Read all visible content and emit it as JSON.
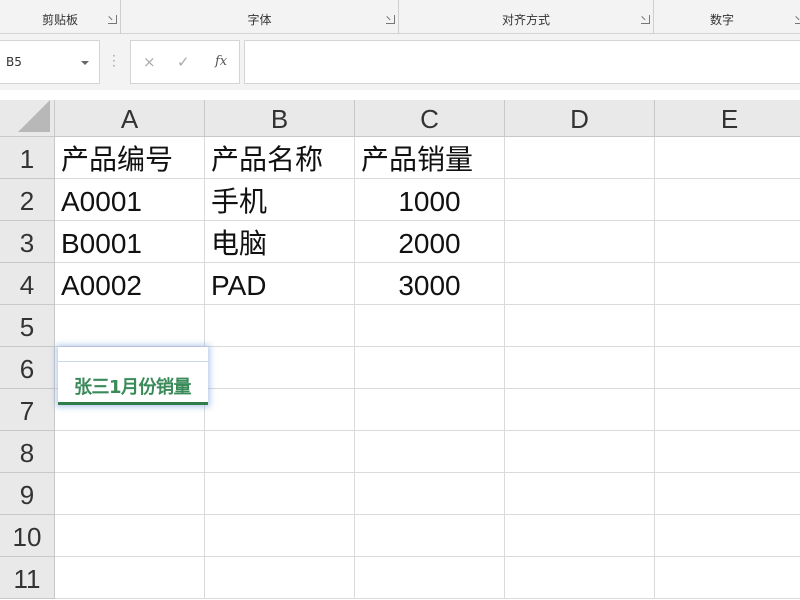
{
  "ribbon": {
    "groups": [
      {
        "label": "剪贴板"
      },
      {
        "label": "字体"
      },
      {
        "label": "对齐方式"
      },
      {
        "label": "数字"
      }
    ]
  },
  "formula_bar": {
    "name_box": "B5",
    "cancel_icon": "×",
    "enter_icon": "✓",
    "fx_icon": "fx",
    "formula": ""
  },
  "sheet": {
    "columns": [
      "A",
      "B",
      "C",
      "D",
      "E"
    ],
    "rows": [
      "1",
      "2",
      "3",
      "4",
      "5",
      "6",
      "7",
      "8",
      "9",
      "10",
      "11"
    ],
    "cells": {
      "A1": "产品编号",
      "B1": "产品名称",
      "C1": "产品销量",
      "A2": "A0001",
      "B2": "手机",
      "C2": "1000",
      "A3": "B0001",
      "B3": "电脑",
      "C3": "2000",
      "A4": "A0002",
      "B4": "PAD",
      "C4": "3000"
    }
  },
  "floating_text": "张三1月份销量",
  "colors": {
    "float_text": "#3a8a5a",
    "float_underline": "#2e7d4a",
    "header_bg": "#e9e9e9"
  }
}
